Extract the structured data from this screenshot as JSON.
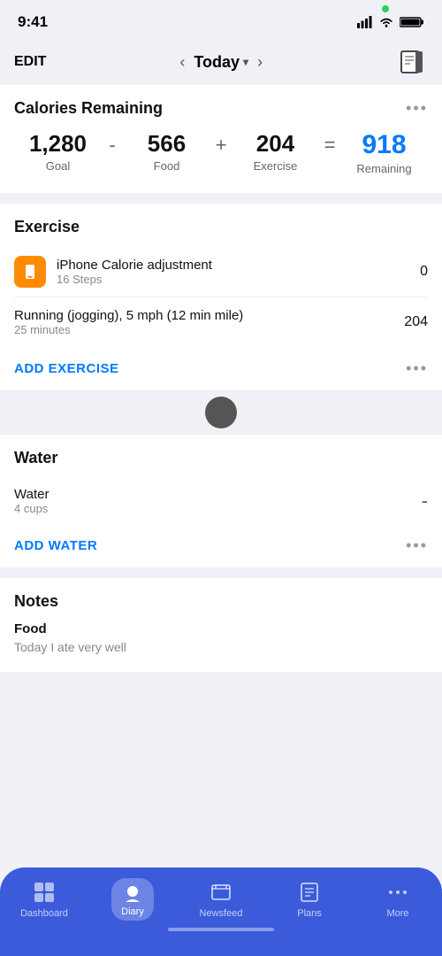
{
  "statusBar": {
    "time": "9:41",
    "moonIcon": "🌙"
  },
  "navBar": {
    "editLabel": "EDIT",
    "todayLabel": "Today",
    "bookIconAlt": "diary-book-icon"
  },
  "caloriesSection": {
    "title": "Calories Remaining",
    "dotsLabel": "•••",
    "goal": {
      "value": "1,280",
      "label": "Goal"
    },
    "minusOp": "-",
    "food": {
      "value": "566",
      "label": "Food"
    },
    "plusOp": "+",
    "exercise": {
      "value": "204",
      "label": "Exercise"
    },
    "equalsOp": "=",
    "remaining": {
      "value": "918",
      "label": "Remaining"
    }
  },
  "exerciseSection": {
    "title": "Exercise",
    "items": [
      {
        "name": "iPhone Calorie adjustment",
        "sub": "16 Steps",
        "calories": "0",
        "hasIcon": true
      }
    ],
    "runningItem": {
      "name": "Running (jogging), 5 mph (12 min mile)",
      "sub": "25 minutes",
      "calories": "204"
    },
    "addLabel": "ADD EXERCISE",
    "dotsLabel": "•••"
  },
  "waterSection": {
    "title": "Water",
    "waterItem": {
      "name": "Water",
      "sub": "4 cups",
      "action": "-"
    },
    "addLabel": "ADD WATER",
    "dotsLabel": "•••"
  },
  "notesSection": {
    "title": "Notes",
    "foodLabel": "Food",
    "foodText": "Today I ate very well"
  },
  "bottomNav": {
    "items": [
      {
        "label": "Dashboard",
        "icon": "dashboard",
        "active": false
      },
      {
        "label": "Diary",
        "icon": "diary",
        "active": true
      },
      {
        "label": "Newsfeed",
        "icon": "newsfeed",
        "active": false
      },
      {
        "label": "Plans",
        "icon": "plans",
        "active": false
      },
      {
        "label": "More",
        "icon": "more",
        "active": false
      }
    ]
  }
}
